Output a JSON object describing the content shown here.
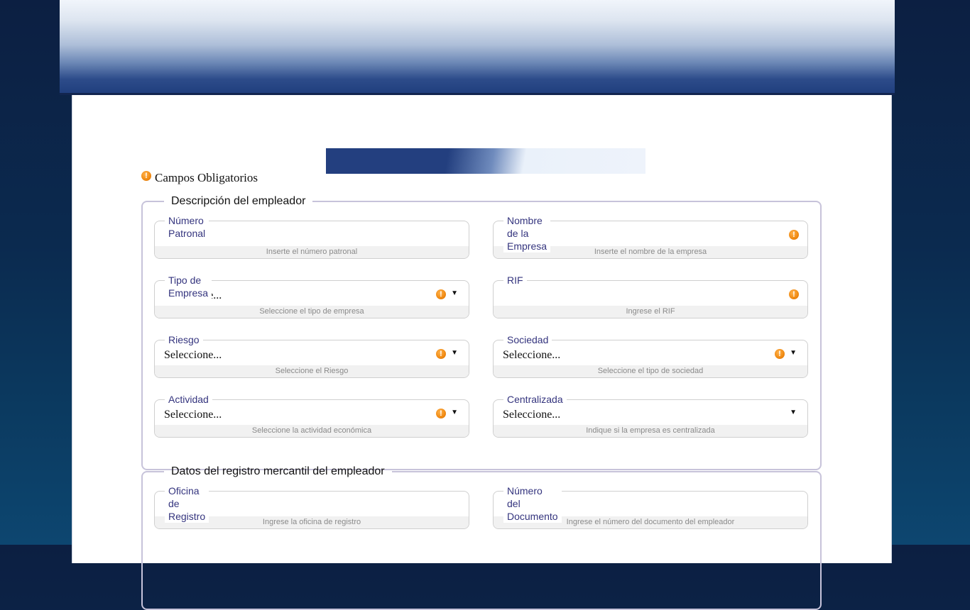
{
  "header": {
    "banner": "site-banner"
  },
  "required_note": "Campos Obligatorios",
  "groups": [
    {
      "legend": "Descripción del empleador"
    },
    {
      "legend": "Datos del registro mercantil del empleador"
    }
  ],
  "fields": {
    "numero_patronal": {
      "label": "Número Patronal",
      "value": "",
      "hint": "Inserte el número patronal"
    },
    "nombre_empresa": {
      "label": "Nombre de la Empresa",
      "value": "",
      "hint": "Inserte el nombre de la empresa"
    },
    "tipo_empresa": {
      "label": "Tipo de Empresa",
      "value": "Seleccione...",
      "hint": "Seleccione el tipo de empresa"
    },
    "rif": {
      "label": "RIF",
      "value": "",
      "hint": "Ingrese el RIF"
    },
    "riesgo": {
      "label": "Riesgo",
      "value": "Seleccione...",
      "hint": "Seleccione el Riesgo"
    },
    "sociedad": {
      "label": "Sociedad",
      "value": "Seleccione...",
      "hint": "Seleccione el tipo de sociedad"
    },
    "actividad": {
      "label": "Actividad",
      "value": "Seleccione...",
      "hint": "Seleccione la actividad económica"
    },
    "centralizada": {
      "label": "Centralizada",
      "value": "Seleccione...",
      "hint": "Indique si la empresa es centralizada"
    },
    "oficina_registro": {
      "label": "Oficina de Registro",
      "value": "",
      "hint": "Ingrese la oficina de registro"
    },
    "numero_documento": {
      "label": "Número del Documento",
      "value": "",
      "hint": "Ingrese el número del documento del empleador"
    }
  },
  "icons": {
    "required": "exclamation-circle-icon",
    "dropdown": "triangle-down-icon"
  },
  "colors": {
    "required_icon": "#f08a12",
    "label": "#34347e",
    "group_border": "#c7c3da"
  }
}
